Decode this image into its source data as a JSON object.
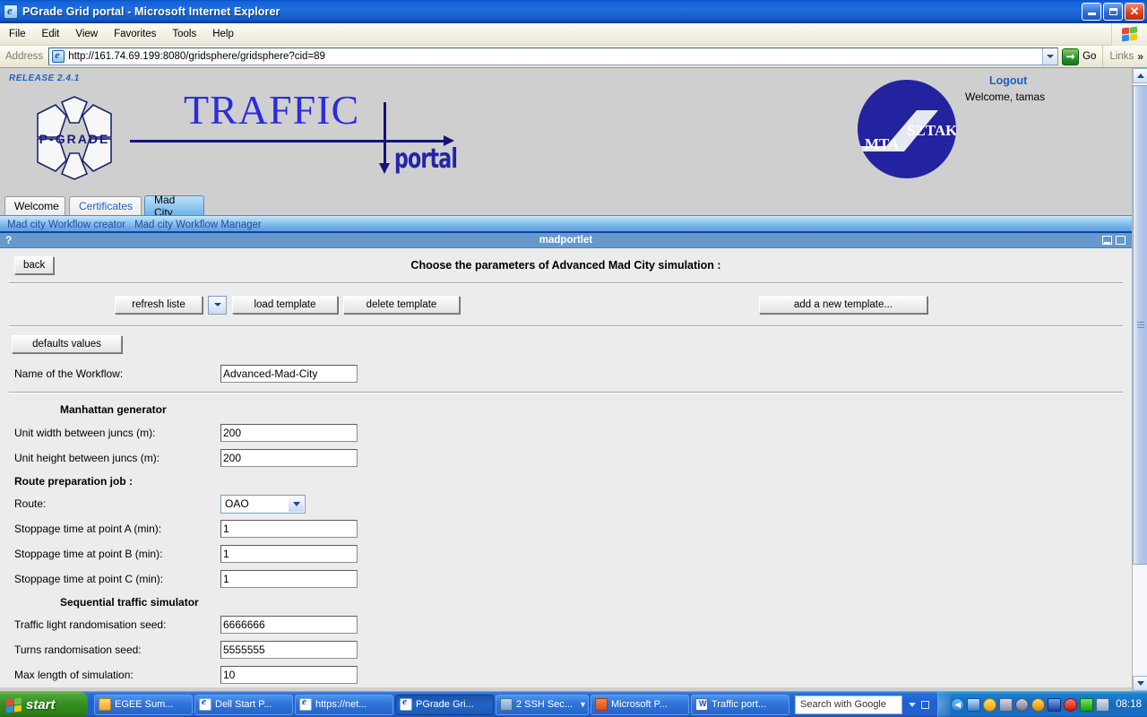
{
  "browser": {
    "title": "PGrade Grid portal - Microsoft Internet Explorer",
    "title_icon": "ie-document-icon",
    "menus": [
      "File",
      "Edit",
      "View",
      "Favorites",
      "Tools",
      "Help"
    ],
    "address_label": "Address",
    "url": "http://161.74.69.199:8080/gridsphere/gridsphere?cid=89",
    "go_label": "Go",
    "links_label": "Links",
    "links_chevron": "»",
    "window_buttons": {
      "minimize": "minimize-icon",
      "maximize": "maximize-icon",
      "close": "✕"
    }
  },
  "portal": {
    "release": "RELEASE 2.4.1",
    "logo_word": "P-GRADE",
    "traffic_word": "TRAFFIC",
    "portal_word": "portal",
    "sztaki": {
      "left": "MTA",
      "right": "SZTAKI"
    },
    "logout": "Logout",
    "welcome": "Welcome, tamas",
    "tabs": [
      {
        "label": "Welcome",
        "state": "inactive"
      },
      {
        "label": "Certificates",
        "state": "inactive-link"
      },
      {
        "label": "Mad City",
        "state": "active"
      }
    ],
    "navlinks": [
      "Mad city Workflow creator",
      "Mad city Workflow Manager"
    ]
  },
  "portlet": {
    "help_glyph": "?",
    "name": "madportlet",
    "minimize_icon": "portlet-minimize-icon",
    "maximize_icon": "portlet-maximize-icon",
    "back_label": "back",
    "heading": "Choose the parameters of Advanced Mad City simulation :",
    "toolbar": {
      "refresh_label": "refresh liste",
      "template_select_value": "",
      "load_label": "load template",
      "delete_label": "delete template",
      "add_label": "add a new template..."
    },
    "defaults_label": "defaults values",
    "workflow_name": {
      "label": "Name of the Workflow:",
      "value": "Advanced-Mad-City"
    },
    "sections": [
      {
        "title": "Manhattan generator",
        "indent": true,
        "fields": [
          {
            "label": "Unit width between juncs (m):",
            "type": "text",
            "value": "200"
          },
          {
            "label": "Unit height between juncs (m):",
            "type": "text",
            "value": "200"
          }
        ]
      },
      {
        "title": "Route preparation job :",
        "indent": false,
        "fields": [
          {
            "label": "Route:",
            "type": "select",
            "value": "OAO"
          },
          {
            "label": "Stoppage time at point A (min):",
            "type": "text",
            "value": "1"
          },
          {
            "label": "Stoppage time at point B (min):",
            "type": "text",
            "value": "1"
          },
          {
            "label": "Stoppage time at point C (min):",
            "type": "text",
            "value": "1"
          }
        ]
      },
      {
        "title": "Sequential traffic simulator",
        "indent": true,
        "fields": [
          {
            "label": "Traffic light randomisation seed:",
            "type": "text",
            "value": "6666666"
          },
          {
            "label": "Turns randomisation seed:",
            "type": "text",
            "value": "5555555"
          },
          {
            "label": "Max length of simulation:",
            "type": "text",
            "value": "10"
          }
        ]
      }
    ]
  },
  "taskbar": {
    "start_label": "start",
    "tasks": [
      {
        "label": "EGEE Sum...",
        "icon": "folder-icon",
        "active": false
      },
      {
        "label": "Dell Start P...",
        "icon": "ie-icon",
        "active": false
      },
      {
        "label": "https://net...",
        "icon": "ie-icon",
        "active": false
      },
      {
        "label": "PGrade Gri...",
        "icon": "ie-icon",
        "active": true
      },
      {
        "label": "2 SSH Sec...",
        "icon": "ssh-group-icon",
        "active": false
      },
      {
        "label": "Microsoft P...",
        "icon": "powerpoint-icon",
        "active": false
      },
      {
        "label": "Traffic port...",
        "icon": "word-icon",
        "active": false
      }
    ],
    "search_box": "Search with Google",
    "clock": "08:18",
    "tray_icons": [
      "network-icon",
      "warning-icon",
      "network-disconnected-icon",
      "sound-muted-icon",
      "update-icon",
      "battery-icon",
      "antivirus-icon",
      "wireless-icon",
      "display-icon"
    ]
  },
  "colors": {
    "accent_blue": "#1c62c4",
    "portlet_header": "#6699cc",
    "page_bg": "#cfcfcf",
    "form_bg": "#ececec",
    "logo_blue": "#2323a0"
  }
}
